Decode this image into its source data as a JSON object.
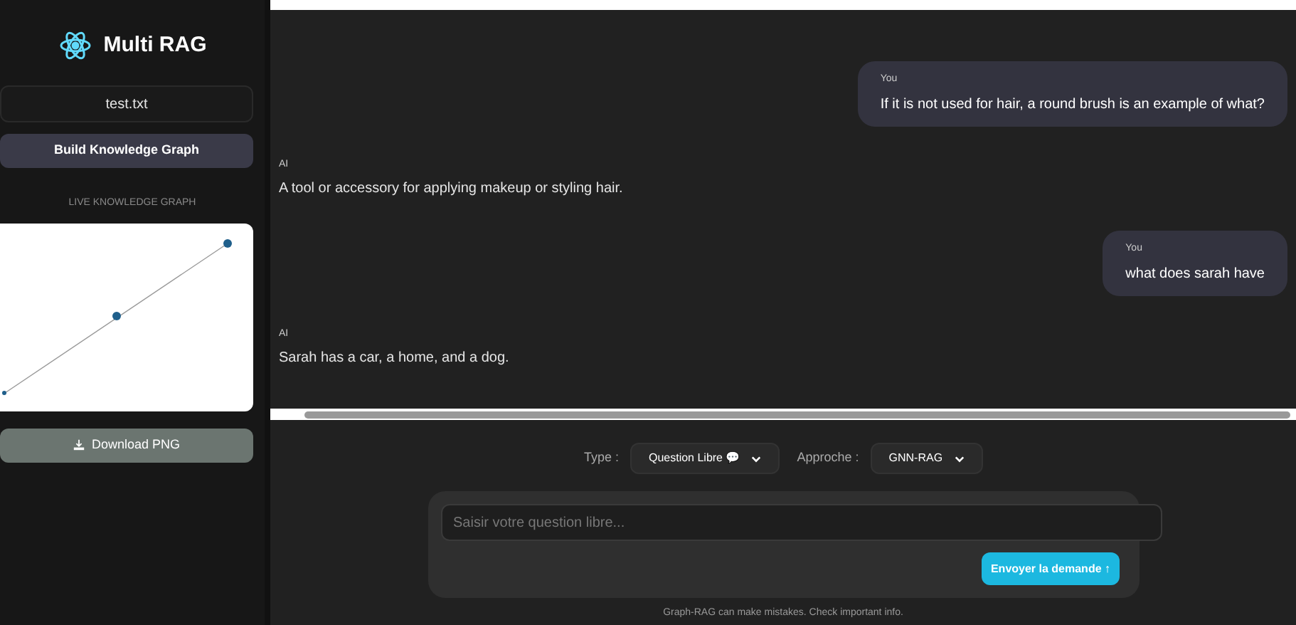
{
  "sidebar": {
    "title": "Multi RAG",
    "file": "test.txt",
    "build_button": "Build Knowledge Graph",
    "graph_heading": "LIVE KNOWLEDGE GRAPH",
    "download_button": "Download PNG"
  },
  "messages": [
    {
      "kind": "user",
      "author": "You",
      "text": "If it is not used for hair, a round brush is an example of what?"
    },
    {
      "kind": "ai",
      "author": "AI",
      "text": "A tool or accessory for applying makeup or styling hair."
    },
    {
      "kind": "user",
      "author": "You",
      "text": "what does sarah have"
    },
    {
      "kind": "ai",
      "author": "AI",
      "text": "Sarah has a car, a home, and a dog."
    }
  ],
  "controls": {
    "type_label": "Type :",
    "type_value": "Question Libre 💬",
    "approach_label": "Approche :",
    "approach_value": "GNN-RAG"
  },
  "composer": {
    "placeholder": "Saisir votre question libre...",
    "send_button": "Envoyer la demande ↑"
  },
  "disclaimer": "Graph-RAG can make mistakes. Check important info."
}
